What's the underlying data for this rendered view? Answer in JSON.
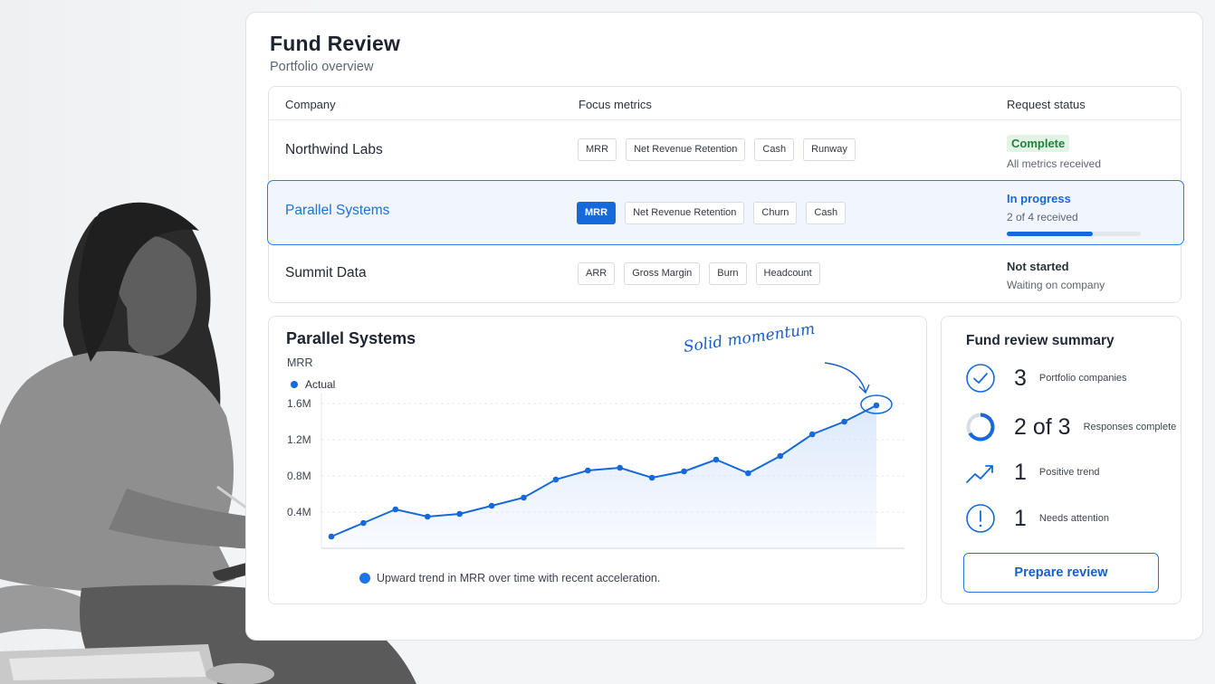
{
  "header": {
    "title": "Fund Review",
    "subtitle": "Portfolio overview"
  },
  "table": {
    "columns": [
      "Company",
      "Focus metrics",
      "Request status"
    ],
    "rows": [
      {
        "company": "Northwind Labs",
        "tags": [
          "MRR",
          "Net Revenue Retention",
          "Cash",
          "Runway"
        ],
        "status_badge": "Complete",
        "status_detail": "All metrics received"
      },
      {
        "company": "Parallel Systems",
        "tags": [
          "MRR",
          "Net Revenue Retention",
          "Churn",
          "Cash"
        ],
        "status_title": "In progress",
        "status_detail": "2 of 4 received",
        "progress": 0.64
      },
      {
        "company": "Summit Data",
        "tags": [
          "ARR",
          "Gross Margin",
          "Burn",
          "Headcount"
        ],
        "status_title": "Not started",
        "status_detail": "Waiting on company"
      }
    ]
  },
  "chart": {
    "title": "Parallel Systems",
    "annotation": "Solid momentum",
    "caption": "Upward trend in MRR over time with recent acceleration."
  },
  "chart_data": {
    "type": "area",
    "title": "Parallel Systems",
    "ylabel": "MRR",
    "xlabel": "",
    "x": [
      1,
      2,
      3,
      4,
      5,
      6,
      7,
      8,
      9,
      10,
      11,
      12,
      13,
      14,
      15,
      16,
      17,
      18
    ],
    "series": [
      {
        "name": "Actual",
        "values": [
          0.13,
          0.28,
          0.43,
          0.35,
          0.38,
          0.47,
          0.56,
          0.76,
          0.86,
          0.89,
          0.78,
          0.85,
          0.98,
          0.83,
          1.02,
          1.26,
          1.4,
          1.58
        ]
      }
    ],
    "ylim": [
      0,
      1.7
    ],
    "yticks": [
      0.4,
      0.8,
      1.2,
      1.6
    ],
    "ytick_labels": [
      "0.4M",
      "0.8M",
      "1.2M",
      "1.6M"
    ],
    "grid": true,
    "legend": "top-left",
    "highlight_last_point": true,
    "color": "#1669db"
  },
  "summary": {
    "title": "Fund review summary",
    "stats": [
      {
        "value": "3",
        "label": "Portfolio companies",
        "icon": "check-circle-icon"
      },
      {
        "value": "2 of 3",
        "label": "Responses complete",
        "icon": "partial-ring-icon"
      },
      {
        "value": "1",
        "label": "Positive trend",
        "icon": "trend-up-icon"
      },
      {
        "value": "1",
        "label": "Needs attention",
        "icon": "alert-circle-icon"
      }
    ],
    "button": "Prepare review"
  },
  "colors": {
    "accent": "#1669db",
    "success_bg": "#e3f4e6",
    "success_text": "#21813b"
  }
}
